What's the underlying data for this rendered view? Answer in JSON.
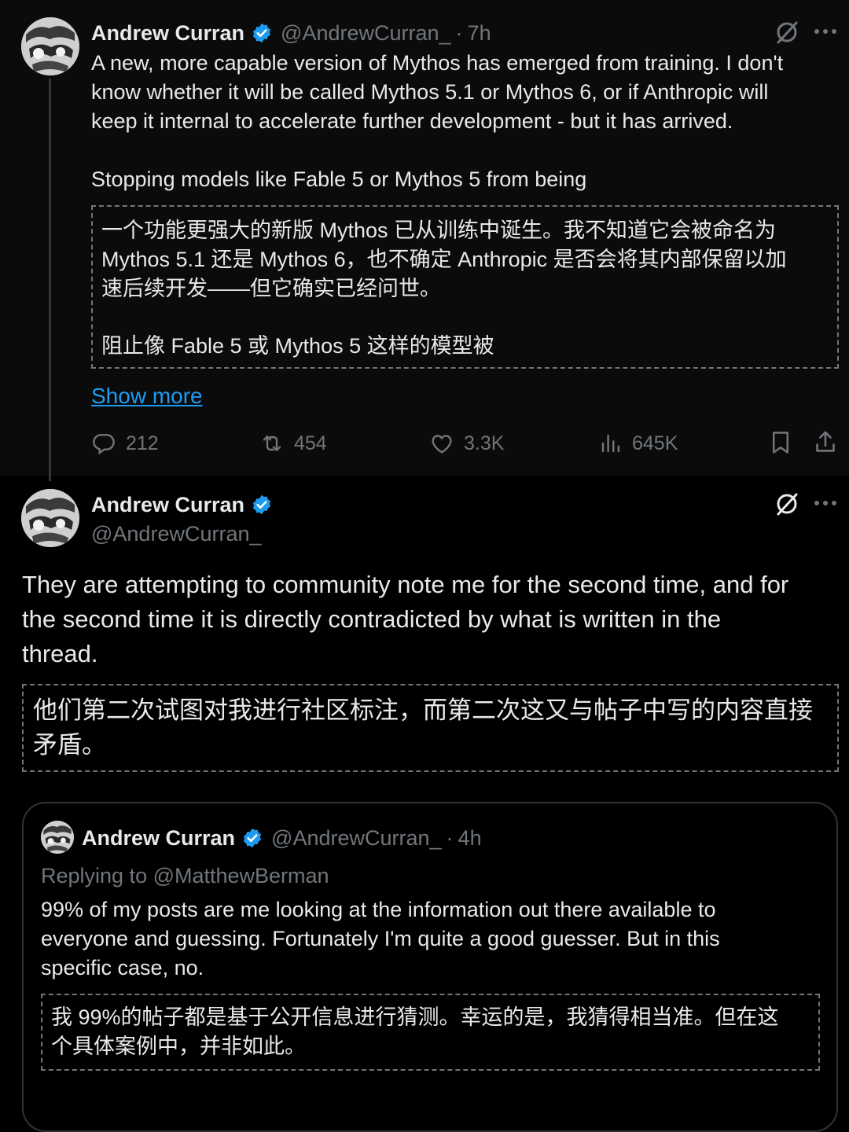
{
  "post1": {
    "author_name": "Andrew Curran",
    "handle": "@AndrewCurran_",
    "sep": "·",
    "time": "7h",
    "text_lines": [
      "A new, more capable version of Mythos has emerged from training. I don't",
      "know whether it will be called Mythos 5.1 or Mythos 6, or if Anthropic will",
      "keep it internal to accelerate further development - but it has arrived."
    ],
    "text_line4": "Stopping models like Fable 5 or Mythos 5 from being",
    "translation_lines": [
      "一个功能更强大的新版 Mythos 已从训练中诞生。我不知道它会被命名为",
      "Mythos 5.1 还是 Mythos 6，也不确定 Anthropic 是否会将其内部保留以加",
      "速后续开发——但它确实已经问世。"
    ],
    "translation_line4": "阻止像 Fable 5 或 Mythos 5 这样的模型被",
    "show_more": "Show more",
    "stats": {
      "replies": "212",
      "reposts": "454",
      "likes": "3.3K",
      "views": "645K"
    },
    "icons": [
      "grok-icon",
      "more-icon",
      "reply-icon",
      "repost-icon",
      "like-icon",
      "views-icon",
      "bookmark-icon",
      "share-icon"
    ]
  },
  "post2": {
    "author_name": "Andrew Curran",
    "handle": "@AndrewCurran_",
    "text_lines": [
      "They are attempting to community note me for the second time, and for",
      "the second time it is directly contradicted by what is written in the",
      "thread."
    ],
    "translation_lines": [
      "他们第二次试图对我进行社区标注，而第二次这又与帖子中写的内容直接",
      "矛盾。"
    ]
  },
  "quote": {
    "author_name": "Andrew Curran",
    "handle": "@AndrewCurran_",
    "sep": "·",
    "time": "4h",
    "replying_to": "Replying to @MatthewBerman",
    "text_lines": [
      "99% of my posts are me looking at the information out there available to",
      "everyone and guessing. Fortunately I'm quite a good guesser. But in this",
      "specific case, no."
    ],
    "translation_lines": [
      "我 99%的帖子都是基于公开信息进行猜测。幸运的是，我猜得相当准。但在这",
      "个具体案例中，并非如此。"
    ]
  },
  "colors": {
    "background": "#000000",
    "text": "#e7e9ea",
    "muted": "#71767b",
    "link": "#1d9bf0",
    "verified": "#1d9bf0"
  }
}
